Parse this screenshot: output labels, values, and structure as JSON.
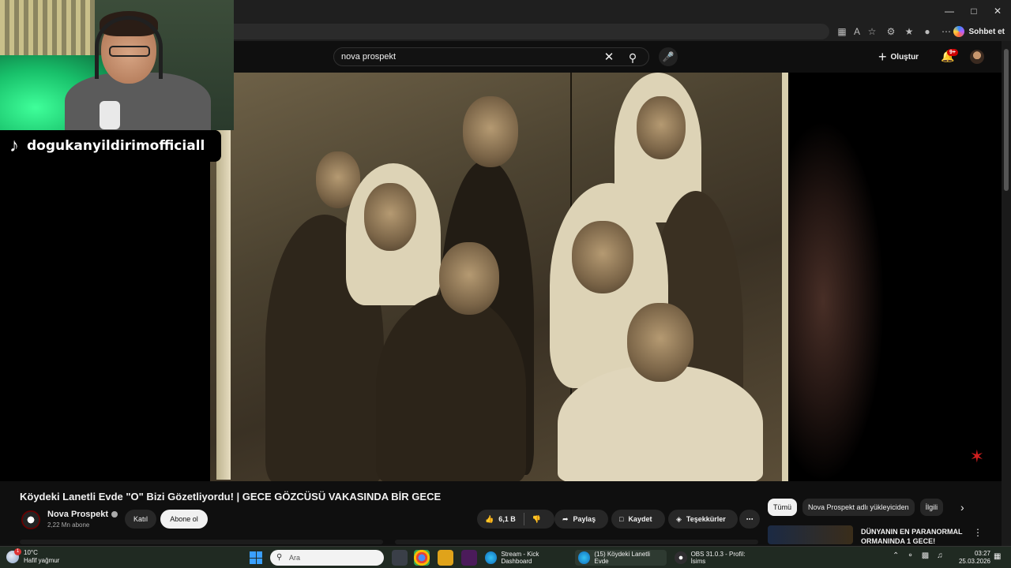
{
  "browser": {
    "copilot_label": "Sohbet et"
  },
  "youtube": {
    "search": {
      "query": "nova prospekt"
    },
    "create_label": "Oluştur",
    "notifications_badge": "9+"
  },
  "stream_overlay": {
    "tiktok_handle": "dogukanyildirimofficiall"
  },
  "video": {
    "title": "Köydeki Lanetli Evde \"O\" Bizi Gözetliyordu! | GECE GÖZCÜSÜ VAKASINDA BİR GECE",
    "channel": {
      "name": "Nova Prospekt",
      "subscribers": "2,22 Mn abone",
      "join_label": "Katıl",
      "subscribe_label": "Abone ol"
    },
    "actions": {
      "likes": "6,1 B",
      "share_label": "Paylaş",
      "save_label": "Kaydet",
      "thanks_label": "Teşekkürler"
    }
  },
  "sidebar": {
    "chips": [
      {
        "label": "Tümü",
        "active": true
      },
      {
        "label": "Nova Prospekt adlı yükleyiciden",
        "active": false
      },
      {
        "label": "İlgili",
        "active": false
      }
    ],
    "recommendation": {
      "title": "DÜNYANIN EN PARANORMAL ORMANINDA 1 GECE!"
    }
  },
  "taskbar": {
    "weather": {
      "temp": "10°C",
      "desc": "Hafif yağmur",
      "badge": "1"
    },
    "search_placeholder": "Ara",
    "tasks": [
      {
        "label": "Stream - Kick Dashboard"
      },
      {
        "label": "(15) Köydeki Lanetli Evde"
      },
      {
        "label": "OBS 31.0.3 - Profil: İsims"
      }
    ],
    "clock": {
      "time": "03:27",
      "date": "25.03.2026"
    }
  },
  "colors": {
    "accent_red": "#cc0000",
    "background": "#0f0f0f",
    "pill": "#272727"
  }
}
